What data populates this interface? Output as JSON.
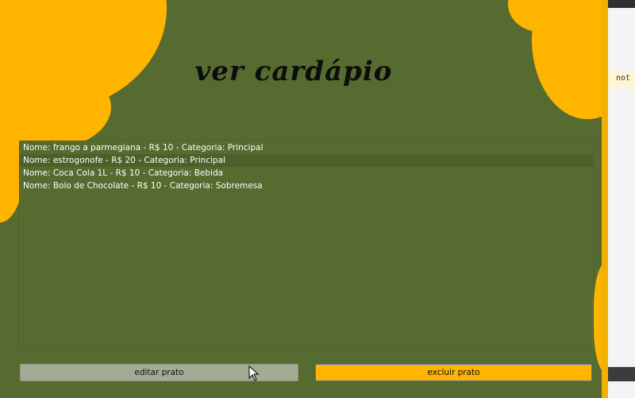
{
  "background_editor": {
    "snippet": "not"
  },
  "window": {
    "title": "ver cardápio",
    "menu_items": [
      "Nome: frango a parmegiana - R$ 10 - Categoria: Principal",
      "Nome: estrogonofe - R$ 20 - Categoria: Principal",
      "Nome: Coca Cola 1L - R$ 10 - Categoria: Bebida",
      "Nome: Bolo de Chocolate - R$ 10 - Categoria: Sobremesa"
    ],
    "buttons": {
      "edit_label": "editar prato",
      "delete_label": "excluir prato"
    }
  },
  "colors": {
    "background": "#556b2f",
    "accent": "#ffb400",
    "edit_button": "#a3ab95"
  }
}
